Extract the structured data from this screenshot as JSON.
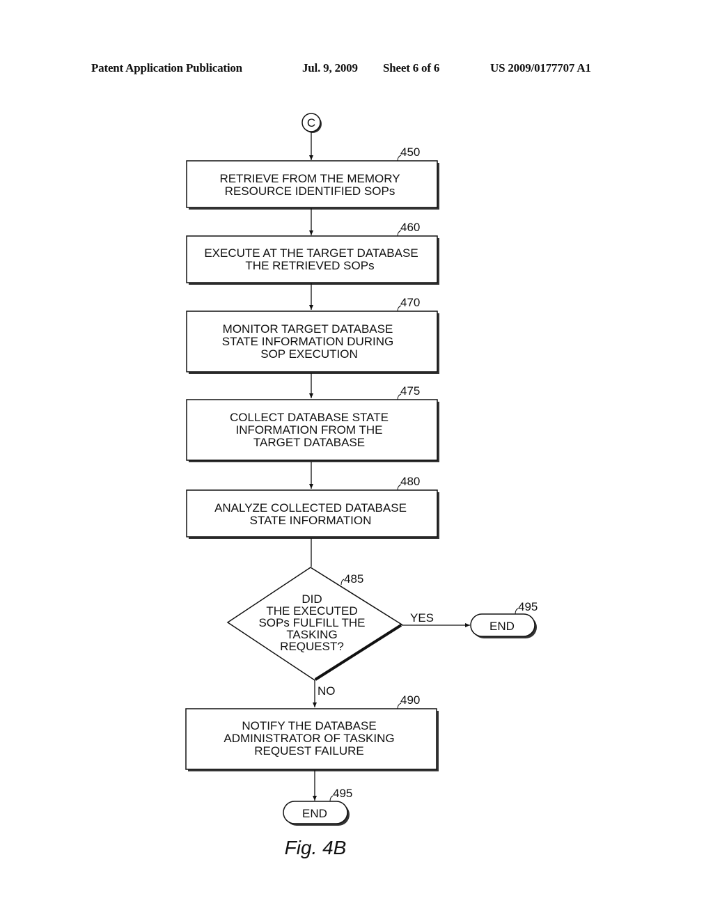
{
  "header": {
    "publication": "Patent Application Publication",
    "date": "Jul. 9, 2009",
    "sheet": "Sheet 6 of 6",
    "number": "US 2009/0177707 A1"
  },
  "flowchart": {
    "connector": {
      "label": "C"
    },
    "steps": [
      {
        "ref": "450",
        "lines": [
          "RETRIEVE FROM THE MEMORY",
          "RESOURCE IDENTIFIED SOPs"
        ]
      },
      {
        "ref": "460",
        "lines": [
          "EXECUTE AT THE TARGET DATABASE",
          "THE RETRIEVED SOPs"
        ]
      },
      {
        "ref": "470",
        "lines": [
          "MONITOR TARGET DATABASE",
          "STATE INFORMATION DURING",
          "SOP EXECUTION"
        ]
      },
      {
        "ref": "475",
        "lines": [
          "COLLECT DATABASE STATE",
          "INFORMATION FROM THE",
          "TARGET DATABASE"
        ]
      },
      {
        "ref": "480",
        "lines": [
          "ANALYZE COLLECTED DATABASE",
          "STATE INFORMATION"
        ]
      }
    ],
    "decision": {
      "ref": "485",
      "lines": [
        "DID",
        "THE EXECUTED",
        "SOPs FULFILL THE",
        "TASKING",
        "REQUEST?"
      ],
      "yes_label": "YES",
      "no_label": "NO"
    },
    "end_yes": {
      "ref": "495",
      "label": "END"
    },
    "failure_step": {
      "ref": "490",
      "lines": [
        "NOTIFY THE DATABASE",
        "ADMINISTRATOR OF TASKING",
        "REQUEST FAILURE"
      ]
    },
    "end_no": {
      "ref": "495",
      "label": "END"
    }
  },
  "figure_label": "Fig. 4B"
}
